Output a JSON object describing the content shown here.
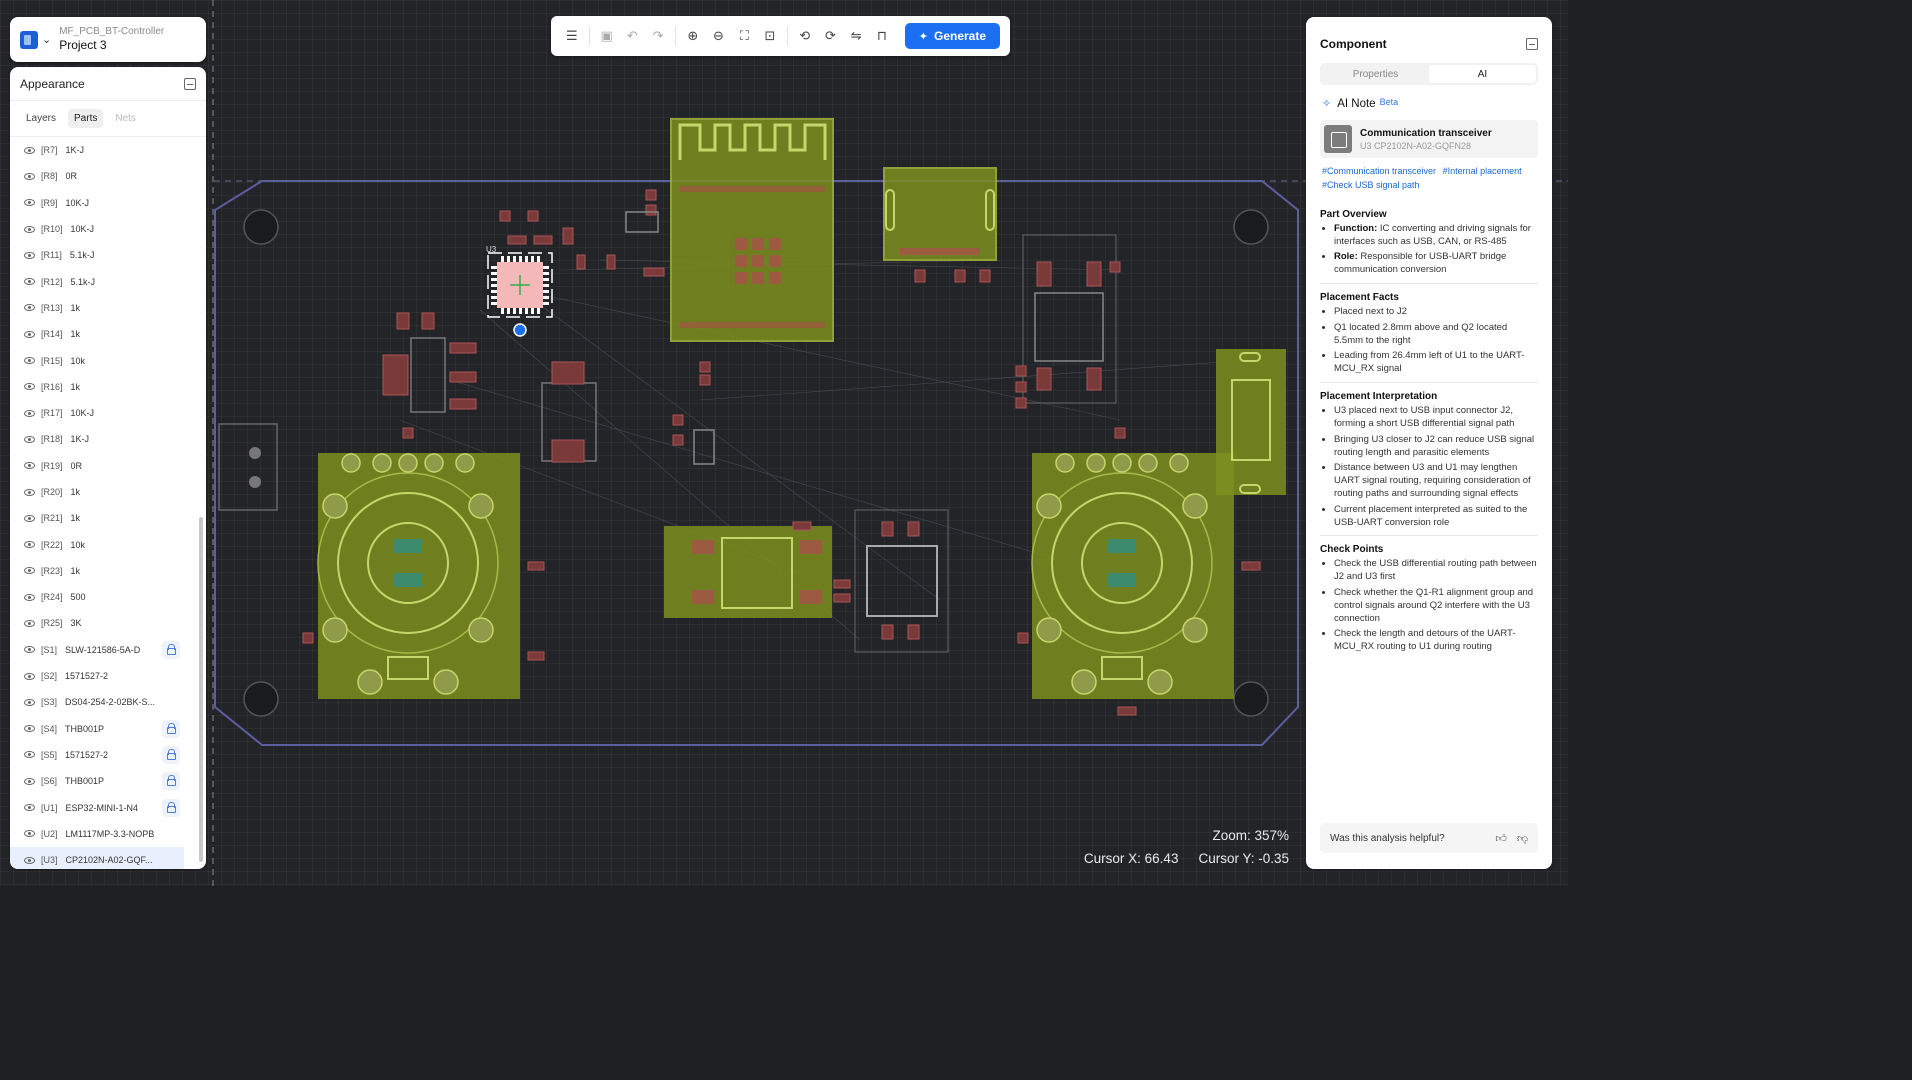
{
  "project": {
    "subtitle": "MF_PCB_BT-Controller",
    "name": "Project 3"
  },
  "appearance": {
    "title": "Appearance",
    "tabs": [
      {
        "label": "Layers"
      },
      {
        "label": "Parts"
      },
      {
        "label": "Nets"
      }
    ],
    "parts": [
      {
        "ref": "[R7]",
        "value": "1K-J",
        "locked": false
      },
      {
        "ref": "[R8]",
        "value": "0R",
        "locked": false
      },
      {
        "ref": "[R9]",
        "value": "10K-J",
        "locked": false
      },
      {
        "ref": "[R10]",
        "value": "10K-J",
        "locked": false
      },
      {
        "ref": "[R11]",
        "value": "5.1k-J",
        "locked": false
      },
      {
        "ref": "[R12]",
        "value": "5.1k-J",
        "locked": false
      },
      {
        "ref": "[R13]",
        "value": "1k",
        "locked": false
      },
      {
        "ref": "[R14]",
        "value": "1k",
        "locked": false
      },
      {
        "ref": "[R15]",
        "value": "10k",
        "locked": false
      },
      {
        "ref": "[R16]",
        "value": "1k",
        "locked": false
      },
      {
        "ref": "[R17]",
        "value": "10K-J",
        "locked": false
      },
      {
        "ref": "[R18]",
        "value": "1K-J",
        "locked": false
      },
      {
        "ref": "[R19]",
        "value": "0R",
        "locked": false
      },
      {
        "ref": "[R20]",
        "value": "1k",
        "locked": false
      },
      {
        "ref": "[R21]",
        "value": "1k",
        "locked": false
      },
      {
        "ref": "[R22]",
        "value": "10k",
        "locked": false
      },
      {
        "ref": "[R23]",
        "value": "1k",
        "locked": false
      },
      {
        "ref": "[R24]",
        "value": "500",
        "locked": false
      },
      {
        "ref": "[R25]",
        "value": "3K",
        "locked": false
      },
      {
        "ref": "[S1]",
        "value": "SLW-121586-5A-D",
        "locked": true
      },
      {
        "ref": "[S2]",
        "value": "1571527-2",
        "locked": false
      },
      {
        "ref": "[S3]",
        "value": "DS04-254-2-02BK-S...",
        "locked": false
      },
      {
        "ref": "[S4]",
        "value": "THB001P",
        "locked": true
      },
      {
        "ref": "[S5]",
        "value": "1571527-2",
        "locked": true
      },
      {
        "ref": "[S6]",
        "value": "THB001P",
        "locked": true
      },
      {
        "ref": "[U1]",
        "value": "ESP32-MINI-1-N4",
        "locked": true
      },
      {
        "ref": "[U2]",
        "value": "LM1117MP-3.3-NOPB",
        "locked": false
      },
      {
        "ref": "[U3]",
        "value": "CP2102N-A02-GQF...",
        "locked": false,
        "selected": true
      }
    ]
  },
  "toolbar": {
    "generate_label": "Generate"
  },
  "board": {
    "selected_label": "U3"
  },
  "component": {
    "title": "Component",
    "tabs": [
      {
        "label": "Properties"
      },
      {
        "label": "AI"
      }
    ],
    "ai_note": "AI Note",
    "beta": "Beta",
    "card_name": "Communication transceiver",
    "card_part": "U3 CP2102N-A02-GQFN28",
    "tags": [
      "#Communication transceiver",
      "#Internal placement",
      "#Check USB signal path"
    ],
    "sections": [
      {
        "title": "Part Overview",
        "items": [
          {
            "label": "Function:",
            "text": " IC converting and driving signals for interfaces such as USB, CAN, or RS-485"
          },
          {
            "label": "Role:",
            "text": " Responsible for USB-UART bridge communication conversion"
          }
        ]
      },
      {
        "title": "Placement Facts",
        "items": [
          {
            "label": "",
            "text": "Placed next to J2"
          },
          {
            "label": "",
            "text": "Q1 located 2.8mm above and Q2 located 5.5mm to the right"
          },
          {
            "label": "",
            "text": "Leading from 26.4mm left of U1 to the UART-MCU_RX signal"
          }
        ]
      },
      {
        "title": "Placement Interpretation",
        "items": [
          {
            "label": "",
            "text": "U3 placed next to USB input connector J2, forming a short USB differential signal path"
          },
          {
            "label": "",
            "text": "Bringing U3 closer to J2 can reduce USB signal routing length and parasitic elements"
          },
          {
            "label": "",
            "text": "Distance between U3 and U1 may lengthen UART signal routing, requiring consideration of routing paths and surrounding signal effects"
          },
          {
            "label": "",
            "text": "Current placement interpreted as suited to the USB-UART conversion role"
          }
        ]
      },
      {
        "title": "Check Points",
        "items": [
          {
            "label": "",
            "text": "Check the USB differential routing path between J2 and U3 first"
          },
          {
            "label": "",
            "text": "Check whether the Q1-R1 alignment group and control signals around Q2 interfere with the U3 connection"
          },
          {
            "label": "",
            "text": "Check the length and detours of the UART-MCU_RX routing to U1 during routing"
          }
        ]
      }
    ],
    "feedback_question": "Was this analysis helpful?"
  },
  "status": {
    "zoom": "Zoom: 357%",
    "cursor_x": "Cursor X: 66.43",
    "cursor_y": "Cursor Y: -0.35"
  }
}
